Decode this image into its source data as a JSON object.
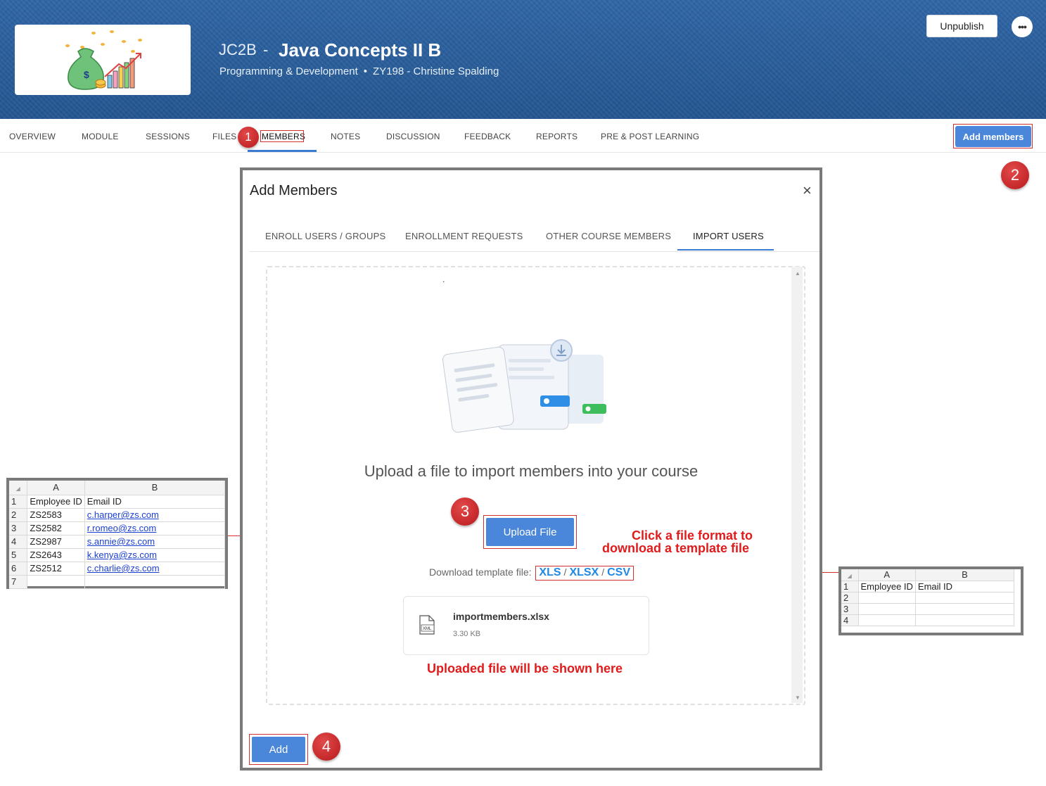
{
  "header": {
    "course_code": "JC2B",
    "separator": "-",
    "course_title": "Java Concepts II B",
    "category": "Programming & Development",
    "instructor": "ZY198 - Christine Spalding",
    "unpublish_label": "Unpublish",
    "more_label": "•••"
  },
  "nav": {
    "items": [
      "OVERVIEW",
      "MODULE",
      "SESSIONS",
      "FILES",
      "MEMBERS",
      "NOTES",
      "DISCUSSION",
      "FEEDBACK",
      "REPORTS",
      "PRE & POST LEARNING"
    ],
    "active": "MEMBERS",
    "add_members_label": "Add members"
  },
  "steps": [
    "1",
    "2",
    "3",
    "4"
  ],
  "modal": {
    "title": "Add Members",
    "close": "×",
    "tabs": [
      "ENROLL USERS / GROUPS",
      "ENROLLMENT REQUESTS",
      "OTHER COURSE MEMBERS",
      "IMPORT USERS"
    ],
    "active_tab": "IMPORT USERS",
    "dot": ".",
    "upload_prompt": "Upload a file to import members into your course",
    "upload_button": "Upload File",
    "template_label": "Download template file:",
    "formats": [
      "XLS",
      "XLSX",
      "CSV"
    ],
    "format_separator": "/",
    "file": {
      "name": "importmembers.xlsx",
      "size": "3.30 KB",
      "icon_text": "XML"
    },
    "add_button": "Add"
  },
  "annotations": {
    "format_hint_line1": "Click a file format to",
    "format_hint_line2": "download a template file",
    "uploaded_hint": "Uploaded file will be shown here"
  },
  "sheet_left": {
    "columns": [
      "A",
      "B"
    ],
    "rows": [
      {
        "n": "1",
        "a": "Employee ID",
        "b": "Email ID",
        "link": false
      },
      {
        "n": "2",
        "a": "ZS2583",
        "b": "c.harper@zs.com",
        "link": true
      },
      {
        "n": "3",
        "a": "ZS2582",
        "b": "r.romeo@zs.com",
        "link": true
      },
      {
        "n": "4",
        "a": "ZS2987",
        "b": "s.annie@zs.com",
        "link": true
      },
      {
        "n": "5",
        "a": "ZS2643",
        "b": "k.kenya@zs.com",
        "link": true
      },
      {
        "n": "6",
        "a": "ZS2512",
        "b": "c.charlie@zs.com",
        "link": true
      },
      {
        "n": "7",
        "a": "",
        "b": "",
        "link": false
      }
    ]
  },
  "sheet_right": {
    "columns": [
      "A",
      "B"
    ],
    "rows": [
      {
        "n": "1",
        "a": "Employee ID",
        "b": "Email ID"
      },
      {
        "n": "2",
        "a": "",
        "b": ""
      },
      {
        "n": "3",
        "a": "",
        "b": ""
      },
      {
        "n": "4",
        "a": "",
        "b": ""
      }
    ]
  },
  "colors": {
    "accent": "#4a86d9",
    "banner": "#2a5d9a",
    "annotation_red": "#e01b1b",
    "badge_red": "#c62828"
  }
}
